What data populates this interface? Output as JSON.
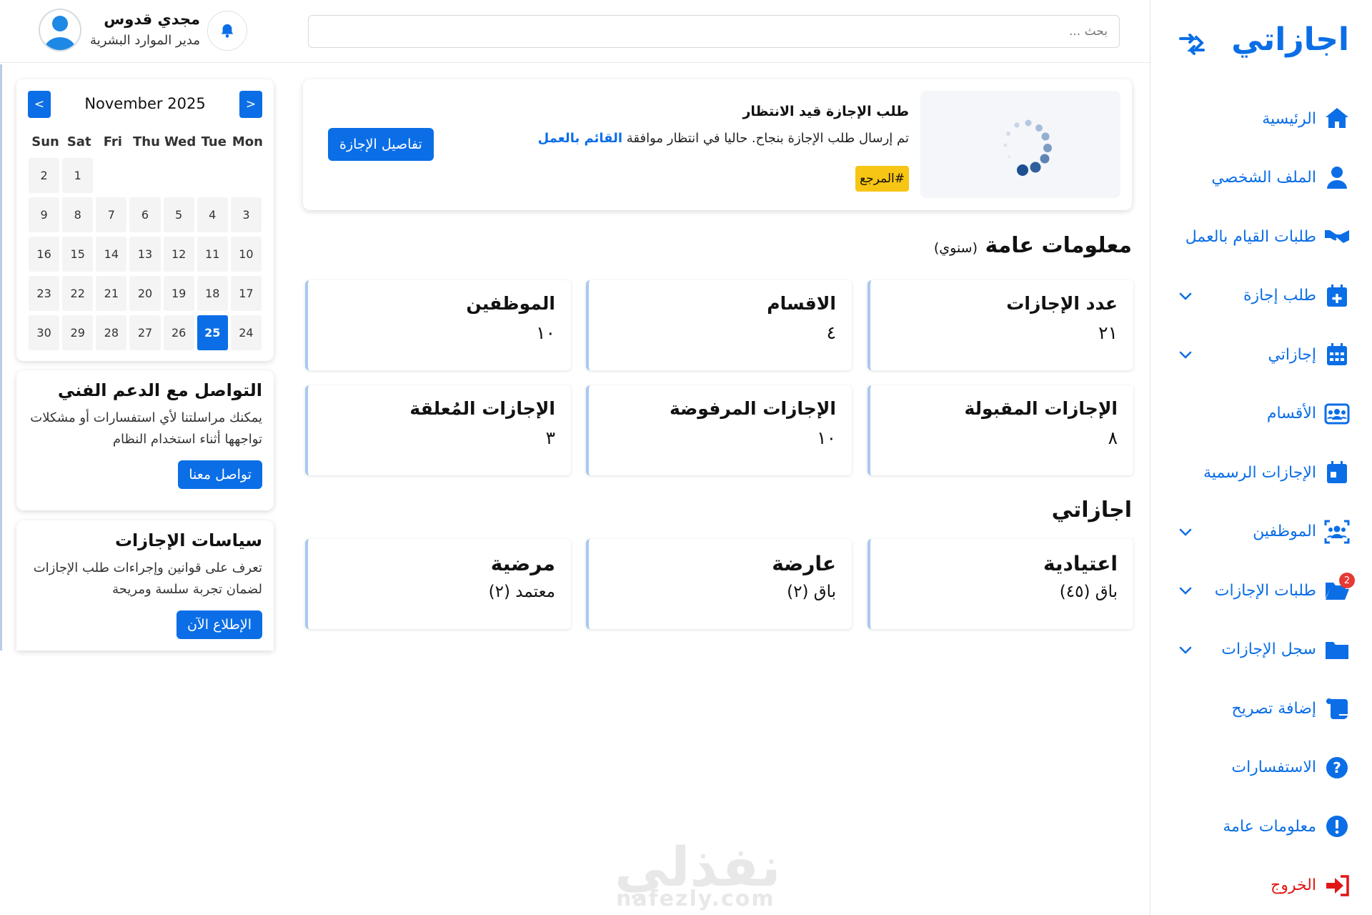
{
  "brand": {
    "title": "اجازاتي"
  },
  "nav": [
    {
      "label": "الرئيسية",
      "icon": "home-icon",
      "chevron": false
    },
    {
      "label": "الملف الشخصي",
      "icon": "user-icon",
      "chevron": false
    },
    {
      "label": "طلبات القيام بالعمل",
      "icon": "handshake-icon",
      "chevron": false
    },
    {
      "label": "طلب إجازة",
      "icon": "calendar-plus-icon",
      "chevron": true
    },
    {
      "label": "إجازاتي",
      "icon": "calendar-days-icon",
      "chevron": true
    },
    {
      "label": "الأقسام",
      "icon": "departments-icon",
      "chevron": false
    },
    {
      "label": "الإجازات الرسمية",
      "icon": "calendar-day-icon",
      "chevron": false
    },
    {
      "label": "الموظفين",
      "icon": "employees-icon",
      "chevron": true
    },
    {
      "label": "طلبات الإجازات",
      "icon": "folder-open-icon",
      "chevron": true,
      "badge": "2"
    },
    {
      "label": "سجل الإجازات",
      "icon": "folder-icon",
      "chevron": true
    },
    {
      "label": "إضافة تصريح",
      "icon": "scroll-icon",
      "chevron": false
    },
    {
      "label": "الاستفسارات",
      "icon": "question-circle-icon",
      "chevron": false
    },
    {
      "label": "معلومات عامة",
      "icon": "info-circle-icon",
      "chevron": false
    },
    {
      "label": "الخروج",
      "icon": "logout-icon",
      "chevron": false,
      "logout": true
    }
  ],
  "header": {
    "search_placeholder": "بحث ...",
    "user_name": "مجدي قدوس",
    "user_role": "مدير الموارد البشرية"
  },
  "calendar": {
    "month_label": "November 2025",
    "prev": "<",
    "next": ">",
    "weekdays": [
      "Sun",
      "Sat",
      "Fri",
      "Thu",
      "Wed",
      "Tue",
      "Mon"
    ],
    "weeks": [
      [
        "2",
        "1",
        "",
        "",
        "",
        "",
        ""
      ],
      [
        "9",
        "8",
        "7",
        "6",
        "5",
        "4",
        "3"
      ],
      [
        "16",
        "15",
        "14",
        "13",
        "12",
        "11",
        "10"
      ],
      [
        "23",
        "22",
        "21",
        "20",
        "19",
        "18",
        "17"
      ],
      [
        "30",
        "29",
        "28",
        "27",
        "26",
        "25",
        "24"
      ]
    ],
    "today": "25"
  },
  "support": {
    "title": "التواصل مع الدعم الفني",
    "text": "يمكنك مراسلتنا لأي استفسارات أو مشكلات تواجهها أثناء استخدام النظام",
    "button": "تواصل معنا"
  },
  "policies": {
    "title": "سياسات الإجازات",
    "text": "تعرف على قوانين وإجراءات طلب الإجازات لضمان تجربة سلسة ومريحة",
    "button": "الإطلاع الآن"
  },
  "pending": {
    "title": "طلب الإجازة قيد الانتظار",
    "message_prefix": "تم إرسال طلب الإجازة بنجاح. حاليا في انتظار موافقة",
    "message_highlight": "القائم بالعمل",
    "reference": "#المرجع",
    "details_button": "تفاصيل الإجازة"
  },
  "general_info": {
    "title": "معلومات عامة",
    "subtitle": "(سنوي)",
    "stats": [
      {
        "label": "عدد الإجازات",
        "value": "٢١"
      },
      {
        "label": "الاقسام",
        "value": "٤"
      },
      {
        "label": "الموظفين",
        "value": "١٠"
      },
      {
        "label": "الإجازات المقبولة",
        "value": "٨"
      },
      {
        "label": "الإجازات المرفوضة",
        "value": "١٠"
      },
      {
        "label": "الإجازات المُعلقة",
        "value": "٣"
      }
    ]
  },
  "my_leaves": {
    "title": "اجازاتي",
    "items": [
      {
        "label": "اعتيادية",
        "value": "باق (٤٥)"
      },
      {
        "label": "عارضة",
        "value": "باق (٢)"
      },
      {
        "label": "مرضية",
        "value": "معتمد (٢)"
      }
    ]
  },
  "watermark": {
    "text": "نفذلي",
    "domain": "nafezly.com"
  },
  "colors": {
    "primary": "#0b6ee6",
    "danger": "#e01616",
    "warning": "#f7c514"
  }
}
